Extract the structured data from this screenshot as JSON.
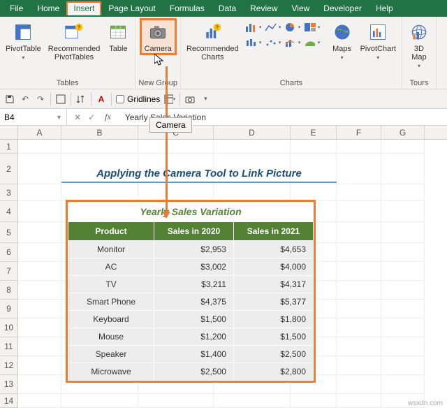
{
  "menubar": {
    "items": [
      "File",
      "Home",
      "Insert",
      "Page Layout",
      "Formulas",
      "Data",
      "Review",
      "View",
      "Developer",
      "Help"
    ],
    "active": "Insert"
  },
  "ribbon": {
    "tables": {
      "label": "Tables",
      "pivottable": "PivotTable",
      "recommended": "Recommended\nPivotTables",
      "table": "Table"
    },
    "newgroup": {
      "label": "New Group",
      "camera": "Camera"
    },
    "charts": {
      "label": "Charts",
      "recommended": "Recommended\nCharts",
      "maps": "Maps",
      "pivotchart": "PivotChart"
    },
    "tours": {
      "label": "Tours",
      "map3d": "3D\nMap"
    }
  },
  "qat": {
    "gridlines": "Gridlines"
  },
  "namebox": "B4",
  "formula": "Yearly Sales Variation",
  "tooltip_camera": "Camera",
  "section_title": "Applying the Camera Tool to Link Picture",
  "table": {
    "title": "Yearly Sales Variation",
    "headers": [
      "Product",
      "Sales in 2020",
      "Sales in 2021"
    ],
    "rows": [
      [
        "Monitor",
        "$2,953",
        "$4,653"
      ],
      [
        "AC",
        "$3,002",
        "$4,000"
      ],
      [
        "TV",
        "$3,211",
        "$4,317"
      ],
      [
        "Smart Phone",
        "$4,375",
        "$5,377"
      ],
      [
        "Keyboard",
        "$1,500",
        "$1,800"
      ],
      [
        "Mouse",
        "$1,200",
        "$1,500"
      ],
      [
        "Speaker",
        "$1,400",
        "$2,500"
      ],
      [
        "Microwave",
        "$2,500",
        "$2,800"
      ]
    ]
  },
  "columns": [
    "A",
    "B",
    "C",
    "D",
    "E",
    "F",
    "G"
  ],
  "row_numbers": [
    "1",
    "2",
    "3",
    "4",
    "5",
    "6",
    "7",
    "8",
    "9",
    "10",
    "11",
    "12",
    "13",
    "14"
  ],
  "watermark": "wsxdn.com"
}
